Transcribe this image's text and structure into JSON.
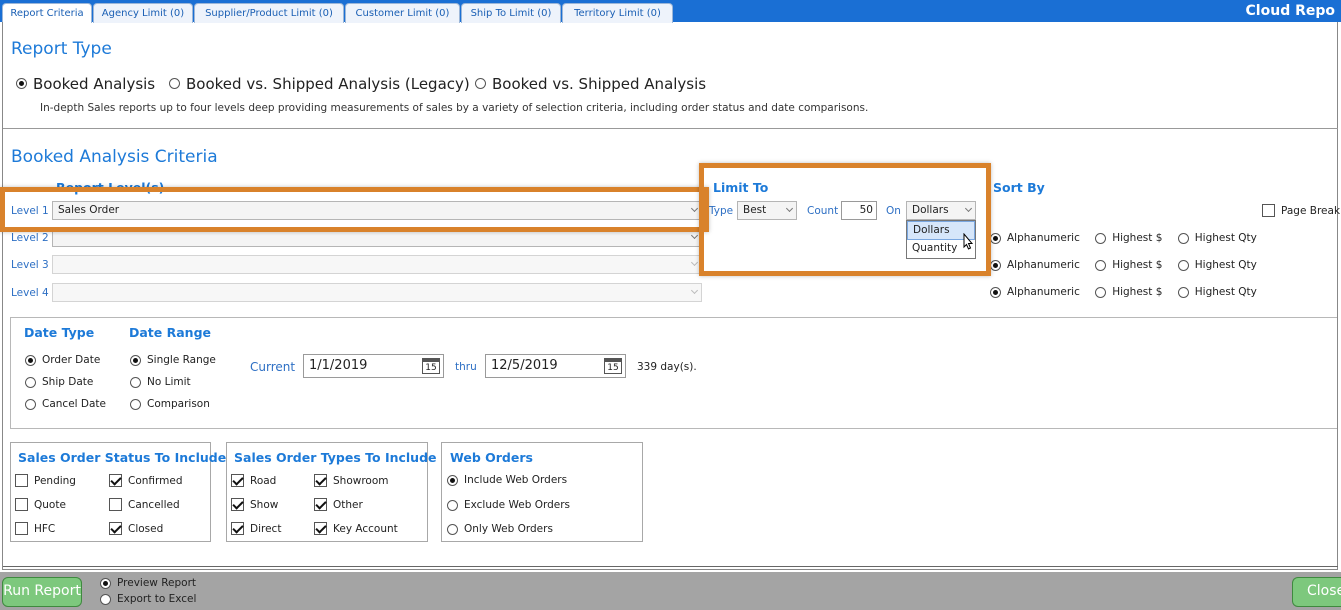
{
  "app_title": "Cloud Repo",
  "tabs": [
    "Report Criteria",
    "Agency Limit (0)",
    "Supplier/Product Limit (0)",
    "Customer Limit (0)",
    "Ship To Limit (0)",
    "Territory Limit (0)"
  ],
  "report_type": {
    "heading": "Report Type",
    "options": [
      "Booked Analysis",
      "Booked vs. Shipped Analysis (Legacy)",
      "Booked vs. Shipped Analysis"
    ],
    "selected": 0,
    "description": "In-depth Sales reports up to four levels deep providing measurements of sales by a variety of selection criteria, including order status and date comparisons."
  },
  "criteria": {
    "heading": "Booked Analysis Criteria",
    "report_levels_label": "Report Level(s)",
    "levels": [
      {
        "label": "Level 1",
        "value": "Sales Order"
      },
      {
        "label": "Level 2",
        "value": ""
      },
      {
        "label": "Level 3",
        "value": ""
      },
      {
        "label": "Level 4",
        "value": ""
      }
    ]
  },
  "limit_to": {
    "heading": "Limit To",
    "type_label": "Type",
    "type_value": "Best",
    "count_label": "Count",
    "count_value": "50",
    "on_label": "On",
    "on_value": "Dollars",
    "on_options": [
      "Dollars",
      "Quantity"
    ]
  },
  "sort_by": {
    "heading": "Sort By",
    "page_break_label": "Page Break",
    "options": [
      "Alphanumeric",
      "Highest $",
      "Highest Qty"
    ]
  },
  "date_type": {
    "heading": "Date Type",
    "options": [
      "Order Date",
      "Ship Date",
      "Cancel Date"
    ],
    "selected": 0
  },
  "date_range": {
    "heading": "Date Range",
    "options": [
      "Single Range",
      "No Limit",
      "Comparison"
    ],
    "selected": 0,
    "current_label": "Current",
    "from": "1/1/2019",
    "thru_label": "thru",
    "to": "12/5/2019",
    "cal_day": "15",
    "days_text": "339 day(s)."
  },
  "status": {
    "heading": "Sales Order Status To Include",
    "items": [
      {
        "label": "Pending",
        "checked": false
      },
      {
        "label": "Confirmed",
        "checked": true
      },
      {
        "label": "Quote",
        "checked": false
      },
      {
        "label": "Cancelled",
        "checked": false
      },
      {
        "label": "HFC",
        "checked": false
      },
      {
        "label": "Closed",
        "checked": true
      }
    ]
  },
  "types": {
    "heading": "Sales Order Types To Include",
    "items": [
      {
        "label": "Road",
        "checked": true
      },
      {
        "label": "Showroom",
        "checked": true
      },
      {
        "label": "Show",
        "checked": true
      },
      {
        "label": "Other",
        "checked": true
      },
      {
        "label": "Direct",
        "checked": true
      },
      {
        "label": "Key Account",
        "checked": true
      }
    ]
  },
  "web_orders": {
    "heading": "Web Orders",
    "options": [
      "Include Web Orders",
      "Exclude Web Orders",
      "Only Web Orders"
    ],
    "selected": 0
  },
  "footer": {
    "run_label": "Run Report",
    "close_label": "Close",
    "output_options": [
      "Preview Report",
      "Export to Excel"
    ],
    "selected": 0
  },
  "colors": {
    "accent": "#1d7ad8",
    "highlight": "#d9822b",
    "footer_bg": "#a4a4a4",
    "button": "#7dc87d"
  }
}
